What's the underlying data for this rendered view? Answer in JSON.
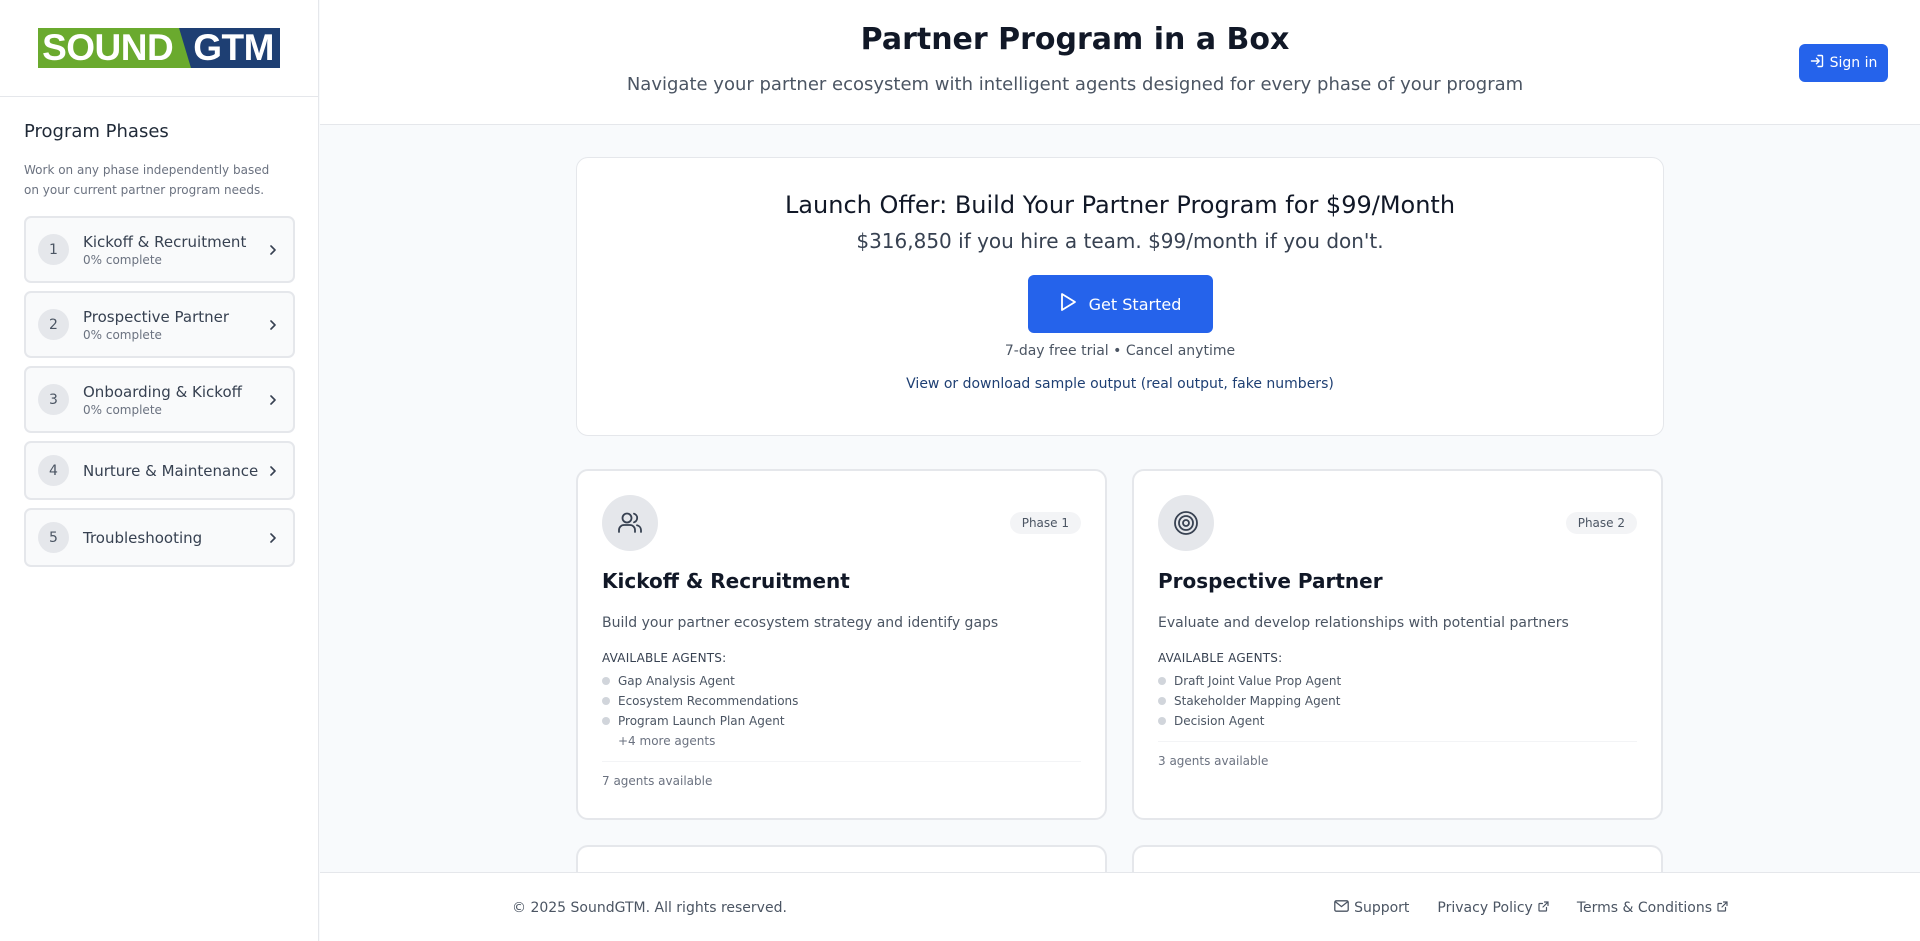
{
  "logo": {
    "part1": "SOUND",
    "part2": "GTM"
  },
  "sidebar": {
    "title": "Program Phases",
    "description": "Work on any phase independently based on your current partner program needs.",
    "phases": [
      {
        "num": "1",
        "name": "Kickoff & Recruitment",
        "progress": "0% complete"
      },
      {
        "num": "2",
        "name": "Prospective Partner",
        "progress": "0% complete"
      },
      {
        "num": "3",
        "name": "Onboarding & Kickoff",
        "progress": "0% complete"
      },
      {
        "num": "4",
        "name": "Nurture & Maintenance"
      },
      {
        "num": "5",
        "name": "Troubleshooting"
      }
    ]
  },
  "header": {
    "title": "Partner Program in a Box",
    "subtitle": "Navigate your partner ecosystem with intelligent agents designed for every phase of your program",
    "signin": "Sign in"
  },
  "offer": {
    "title": "Launch Offer: Build Your Partner Program for $99/Month",
    "subtitle": "$316,850 if you hire a team. $99/month if you don't.",
    "cta": "Get Started",
    "trial": "7-day free trial • Cancel anytime",
    "sample_link": "View or download sample output (real output, fake numbers)"
  },
  "cards": [
    {
      "icon": "users-icon",
      "badge": "Phase 1",
      "title": "Kickoff & Recruitment",
      "description": "Build your partner ecosystem strategy and identify gaps",
      "agents_label": "AVAILABLE AGENTS:",
      "agents": [
        "Gap Analysis Agent",
        "Ecosystem Recommendations",
        "Program Launch Plan Agent"
      ],
      "more": "+4 more agents",
      "footer": "7 agents available"
    },
    {
      "icon": "target-icon",
      "badge": "Phase 2",
      "title": "Prospective Partner",
      "description": "Evaluate and develop relationships with potential partners",
      "agents_label": "AVAILABLE AGENTS:",
      "agents": [
        "Draft Joint Value Prop Agent",
        "Stakeholder Mapping Agent",
        "Decision Agent"
      ],
      "footer": "3 agents available"
    }
  ],
  "footer": {
    "copyright": "© 2025 SoundGTM. All rights reserved.",
    "support": "Support",
    "privacy": "Privacy Policy",
    "terms": "Terms & Conditions"
  },
  "colors": {
    "primary": "#2563eb",
    "brand_green": "#6aaa2e",
    "brand_navy": "#1e3f73"
  }
}
